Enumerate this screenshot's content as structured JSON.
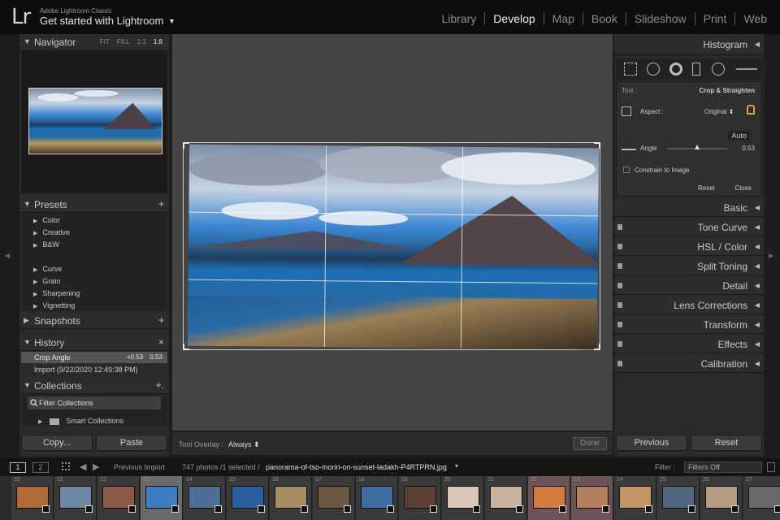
{
  "app": {
    "logo": "Lr",
    "name": "Adobe Lightroom Classic",
    "catalog": "Get started with Lightroom",
    "catalog_arrow": "▼"
  },
  "modules": [
    "Library",
    "Develop",
    "Map",
    "Book",
    "Slideshow",
    "Print",
    "Web"
  ],
  "active_module": "Develop",
  "navigator": {
    "title": "Navigator",
    "options": [
      "FIT",
      "FILL",
      "1:1",
      "1:8"
    ],
    "active_option": "1:8"
  },
  "presets": {
    "title": "Presets",
    "add": "+",
    "items": [
      "Color",
      "Creative",
      "B&W",
      "Curve",
      "Grain",
      "Sharpening",
      "Vignetting"
    ]
  },
  "snapshots": {
    "title": "Snapshots",
    "add": "+"
  },
  "history": {
    "title": "History",
    "close": "×",
    "rows": [
      {
        "name": "Crop Angle",
        "value1": "+0.53",
        "value2": "0.53",
        "selected": true
      },
      {
        "name": "Import (9/22/2020 12:49:38 PM)",
        "value1": "",
        "value2": "",
        "selected": false
      }
    ]
  },
  "collections": {
    "title": "Collections",
    "add": "+.",
    "filter": "Filter Collections",
    "smart": "Smart Collections"
  },
  "left_buttons": {
    "copy": "Copy...",
    "paste": "Paste"
  },
  "toolbar": {
    "overlay_label": "Tool Overlay :",
    "overlay_value": "Always",
    "overlay_arrow": "⬍",
    "done": "Done"
  },
  "right_panels": {
    "histogram": "Histogram",
    "crop": {
      "tool_label": "Tool :",
      "tool_value": "Crop & Straighten",
      "aspect_label": "Aspect :",
      "aspect_value": "Original",
      "auto": "Auto",
      "angle_label": "Angle",
      "angle_value": "0.53",
      "angle_slider": 0.53,
      "constrain": "Constrain to Image",
      "reset": "Reset",
      "close": "Close"
    },
    "sections": [
      "Basic",
      "Tone Curve",
      "HSL / Color",
      "Split Toning",
      "Detail",
      "Lens Corrections",
      "Transform",
      "Effects",
      "Calibration"
    ]
  },
  "right_buttons": {
    "previous": "Previous",
    "reset": "Reset"
  },
  "filmstrip_bar": {
    "view1": "1",
    "view2": "2",
    "source": "Previous Import",
    "count": "747 photos /1 selected /",
    "filename": "panorama-of-tso-moriri-on-sunset-ladakh-P4RTPRN.jpg",
    "filter_label": "Filter :",
    "filter_value": "Filters Off"
  },
  "filmstrip": [
    {
      "num": "10",
      "color": "#b36a3a"
    },
    {
      "num": "11",
      "color": "#6f87a6"
    },
    {
      "num": "12",
      "color": "#8a5a46"
    },
    {
      "num": "13",
      "color": "#3c7fc0"
    },
    {
      "num": "14",
      "color": "#4d6f96"
    },
    {
      "num": "15",
      "color": "#2a5f9e"
    },
    {
      "num": "16",
      "color": "#a78d63"
    },
    {
      "num": "17",
      "color": "#6a5846"
    },
    {
      "num": "18",
      "color": "#3e6ea0"
    },
    {
      "num": "19",
      "color": "#5b4035"
    },
    {
      "num": "20",
      "color": "#d9c7b8"
    },
    {
      "num": "21",
      "color": "#c9b2a0"
    },
    {
      "num": "22",
      "color": "#d07a3e"
    },
    {
      "num": "23",
      "color": "#b2805c"
    },
    {
      "num": "24",
      "color": "#c49464"
    },
    {
      "num": "25",
      "color": "#52677d"
    },
    {
      "num": "26",
      "color": "#b59a82"
    },
    {
      "num": "27",
      "color": "#6a6a6a"
    }
  ]
}
